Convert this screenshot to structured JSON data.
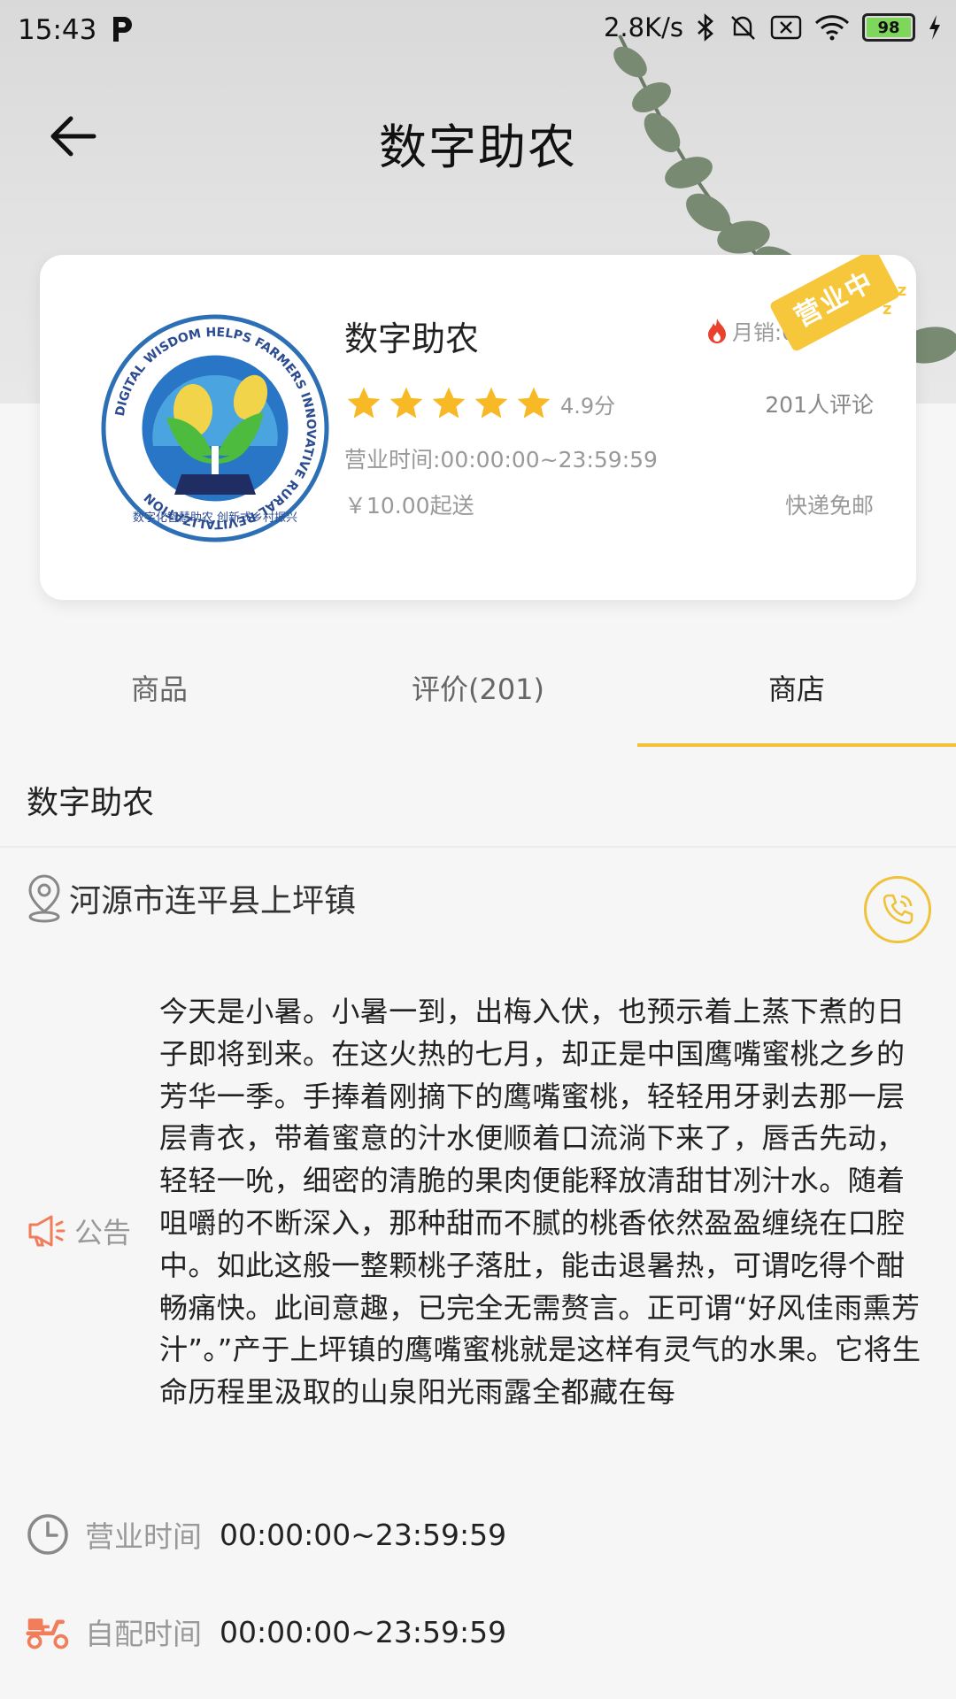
{
  "status_bar": {
    "time": "15:43",
    "network_speed": "2.8K/s",
    "battery": "98"
  },
  "nav": {
    "title": "数字助农"
  },
  "shop": {
    "name": "数字助农",
    "monthly_sales": "月销:0单",
    "rating": 4.9,
    "score_text": "4.9分",
    "reviews": "201人评论",
    "hours": "营业时间:00:00:00~23:59:59",
    "min_order": "￥10.00起送",
    "delivery": "快递免邮",
    "status_badge": "营业中",
    "logo_text": "DIGITAL WISDOM HELPS FARMERS INNOVATIVE RURAL REVITALIZATION",
    "logo_text_cn": "数字化智慧助农 创新式乡村振兴"
  },
  "tabs": [
    {
      "label": "商品"
    },
    {
      "label": "评价(201)"
    },
    {
      "label": "商店"
    }
  ],
  "store": {
    "name": "数字助农",
    "address": "河源市连平县上坪镇",
    "notice_label": "公告",
    "notice_text": "今天是小暑。小暑一到，出梅入伏，也预示着上蒸下煮的日子即将到来。在这火热的七月，却正是中国鹰嘴蜜桃之乡的芳华一季。手捧着刚摘下的鹰嘴蜜桃，轻轻用牙剥去那一层层青衣，带着蜜意的汁水便顺着口流淌下来了，唇舌先动，轻轻一吮，细密的清脆的果肉便能释放清甜甘冽汁水。随着咀嚼的不断深入，那种甜而不腻的桃香依然盈盈缠绕在口腔中。如此这般一整颗桃子落肚，能击退暑热，可谓吃得个酣畅痛快。此间意趣，已完全无需赘言。正可谓“好风佳雨熏芳汁”。”产于上坪镇的鹰嘴蜜桃就是这样有灵气的水果。它将生命历程里汲取的山泉阳光雨露全都藏在每",
    "business_hours_label": "营业时间",
    "business_hours_value": "00:00:00~23:59:59",
    "delivery_time_label": "自配时间",
    "delivery_time_value": "00:00:00~23:59:59"
  },
  "colors": {
    "accent": "#f0c23a",
    "star": "#f7b926",
    "notice_icon": "#f27d5a",
    "scooter_icon": "#f27d5a"
  }
}
